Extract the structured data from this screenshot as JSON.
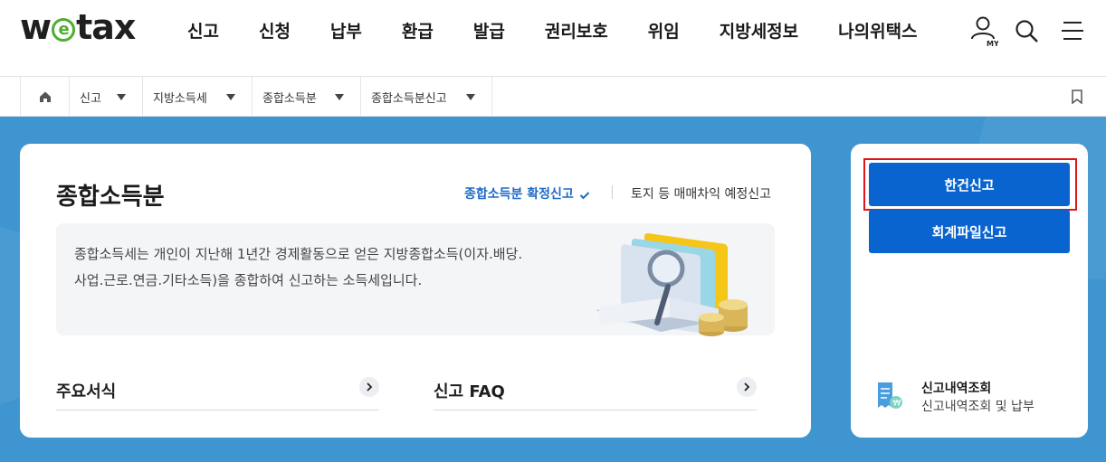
{
  "header": {
    "logo_text": "wetax",
    "nav": [
      "신고",
      "신청",
      "납부",
      "환급",
      "발급",
      "권리보호",
      "위임",
      "지방세정보",
      "나의위택스"
    ],
    "icons": {
      "my": "my-icon",
      "search": "search-icon",
      "menu": "hamburger-menu-icon"
    },
    "my_label": "MY"
  },
  "breadcrumb": {
    "home_icon": "home-icon",
    "items": [
      "신고",
      "지방소득세",
      "종합소득분",
      "종합소득분신고"
    ],
    "bookmark_icon": "bookmark-icon"
  },
  "main": {
    "title": "종합소득분",
    "link_confirm": "종합소득분 확정신고",
    "link_prelim": "토지 등 매매차익 예정신고",
    "description": "종합소득세는 개인이 지난해 1년간 경제활동으로 얻은 지방종합소득(이자.배당.사업.근로.연금.기타소득)을 종합하여 신고하는 소득세입니다.",
    "desc_line1": "종합소득세는 개인이 지난해 1년간 경제활동으로 얻은 지방종합소득(이자.배당.",
    "desc_line2": "사업.근로.연금.기타소득)을 종합하여 신고하는 소득세입니다.",
    "sub_links": [
      "주요서식",
      "신고 FAQ"
    ]
  },
  "side": {
    "btn_single": "한건신고",
    "btn_file": "회계파일신고",
    "history_title": "신고내역조회",
    "history_sub": "신고내역조회 및 납부"
  },
  "colors": {
    "accent": "#0a64cf",
    "background": "#3f95cf",
    "highlight": "#e0141c",
    "logo_green": "#4caf2e"
  }
}
